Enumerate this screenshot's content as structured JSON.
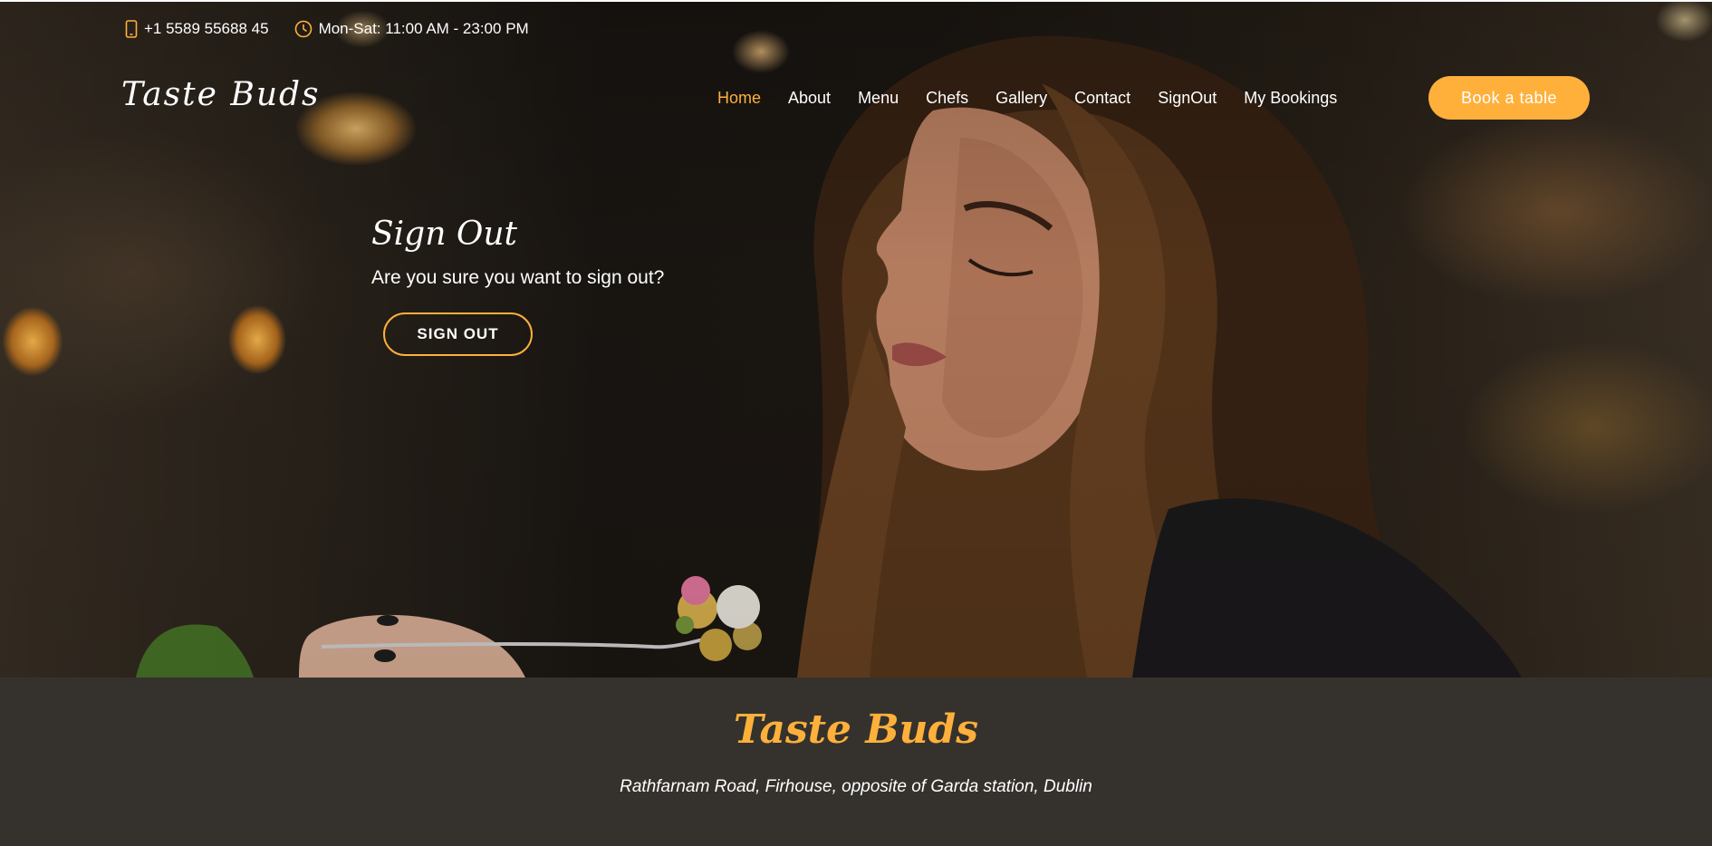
{
  "topbar": {
    "phone": "+1 5589 55688 45",
    "hours": "Mon-Sat: 11:00 AM - 23:00 PM"
  },
  "brand": {
    "logo": "Taste Buds"
  },
  "nav": {
    "items": [
      "Home",
      "About",
      "Menu",
      "Chefs",
      "Gallery",
      "Contact",
      "SignOut",
      "My Bookings"
    ],
    "active": "Home",
    "book_button": "Book a table"
  },
  "signout": {
    "title": "Sign Out",
    "message": "Are you sure you want to sign out?",
    "button": "SIGN OUT"
  },
  "footer": {
    "title": "Taste Buds",
    "address": "Rathfarnam Road, Firhouse, opposite of Garda station, Dublin"
  },
  "colors": {
    "accent": "#ffb03b",
    "footer_bg": "#35322d",
    "text": "#ffffff"
  },
  "icons": [
    "phone-icon",
    "clock-icon"
  ]
}
